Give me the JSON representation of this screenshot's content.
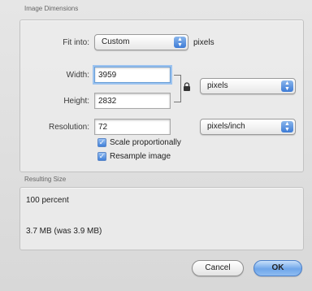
{
  "image_dimensions": {
    "section_title": "Image Dimensions",
    "fit_into_label": "Fit into:",
    "fit_into_value": "Custom",
    "fit_into_unit": "pixels",
    "width_label": "Width:",
    "width_value": "3959",
    "height_label": "Height:",
    "height_value": "2832",
    "size_unit": "pixels",
    "resolution_label": "Resolution:",
    "resolution_value": "72",
    "resolution_unit": "pixels/inch",
    "scale_proportionally_label": "Scale proportionally",
    "scale_proportionally_checked": true,
    "resample_label": "Resample image",
    "resample_checked": true
  },
  "resulting_size": {
    "section_title": "Resulting Size",
    "percent_text": "100 percent",
    "size_text": "3.7 MB (was 3.9 MB)"
  },
  "buttons": {
    "cancel_label": "Cancel",
    "ok_label": "OK"
  },
  "icons": {
    "lock": "lock-icon",
    "popup_arrows": "updown-arrows-icon",
    "checkmark": "checkmark-icon"
  },
  "colors": {
    "accent": "#3d7bd6",
    "focus_ring": "#9cc3ef"
  }
}
